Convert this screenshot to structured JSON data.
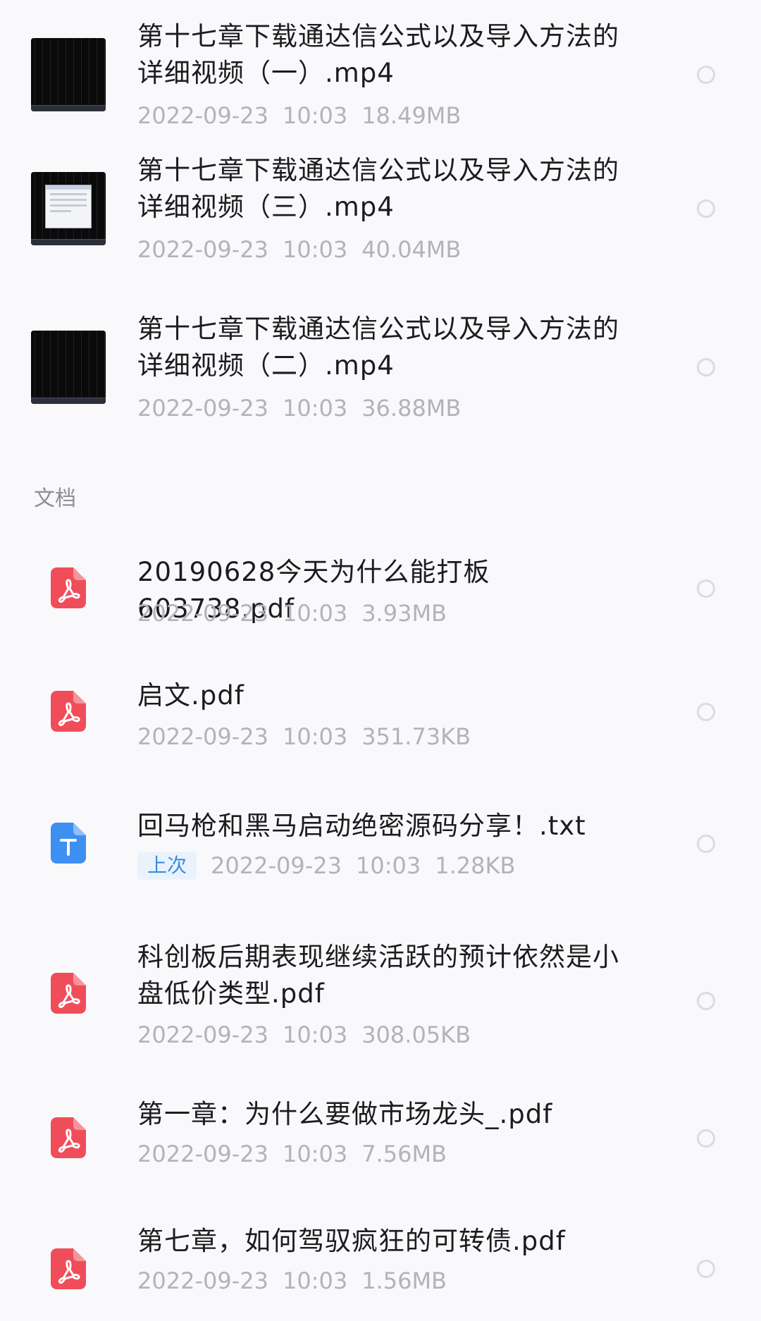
{
  "video_items": [
    {
      "title_line1": "第十七章下载通达信公式以及导入方法的",
      "title_line2": "详细视频（一）.mp4",
      "date": "2022-09-23",
      "time": "10:03",
      "size": "18.49MB",
      "thumb": "video-thumbnail-black"
    },
    {
      "title_line1": "第十七章下载通达信公式以及导入方法的",
      "title_line2": "详细视频（三）.mp4",
      "date": "2022-09-23",
      "time": "10:03",
      "size": "40.04MB",
      "thumb": "video-thumbnail-window"
    },
    {
      "title_line1": "第十七章下载通达信公式以及导入方法的",
      "title_line2": "详细视频（二）.mp4",
      "date": "2022-09-23",
      "time": "10:03",
      "size": "36.88MB",
      "thumb": "video-thumbnail-black"
    }
  ],
  "documents_section_label": "文档",
  "document_items": [
    {
      "title_line1": "20190628今天为什么能打板603738.pdf",
      "title_line2": "",
      "date": "2022-09-23",
      "time": "10:03",
      "size": "3.93MB",
      "icon": "pdf-icon",
      "tag": ""
    },
    {
      "title_line1": "启文.pdf",
      "title_line2": "",
      "date": "2022-09-23",
      "time": "10:03",
      "size": "351.73KB",
      "icon": "pdf-icon",
      "tag": ""
    },
    {
      "title_line1": "回马枪和黑马启动绝密源码分享！.txt",
      "title_line2": "",
      "date": "2022-09-23",
      "time": "10:03",
      "size": "1.28KB",
      "icon": "text-file-icon",
      "tag": "上次"
    },
    {
      "title_line1": "科创板后期表现继续活跃的预计依然是小",
      "title_line2": "盘低价类型.pdf",
      "date": "2022-09-23",
      "time": "10:03",
      "size": "308.05KB",
      "icon": "pdf-icon",
      "tag": ""
    },
    {
      "title_line1": "第一章：为什么要做市场龙头_.pdf",
      "title_line2": "",
      "date": "2022-09-23",
      "time": "10:03",
      "size": "7.56MB",
      "icon": "pdf-icon",
      "tag": ""
    },
    {
      "title_line1": "第七章，如何驾驭疯狂的可转债.pdf",
      "title_line2": "",
      "date": "2022-09-23",
      "time": "10:03",
      "size": "1.56MB",
      "icon": "pdf-icon",
      "tag": ""
    }
  ],
  "colors": {
    "background": "#f9f9fb",
    "pdf_red": "#f04d5a",
    "text_blue": "#3d8ff2",
    "meta_gray": "#b3b3b8"
  }
}
